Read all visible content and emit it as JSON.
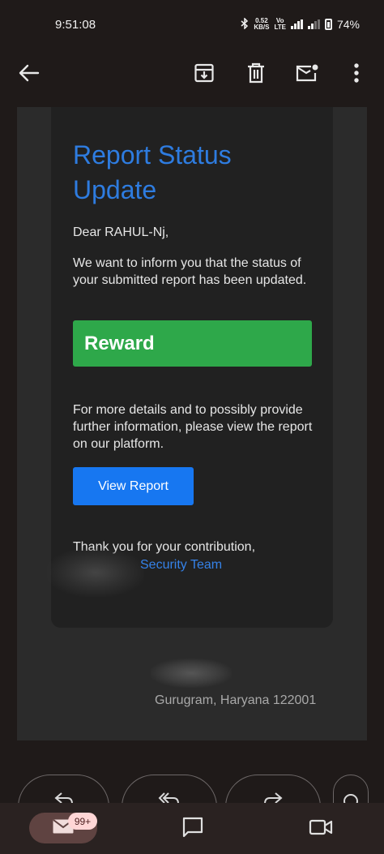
{
  "status_bar": {
    "time": "9:51:08",
    "net_speed_value": "0.52",
    "net_speed_unit": "KB/S",
    "volte_top": "Vo",
    "volte_bottom": "LTE",
    "battery": "74%"
  },
  "toolbar": {
    "icons": [
      "back-arrow-icon",
      "archive-icon",
      "delete-icon",
      "mark-unread-icon",
      "more-vert-icon"
    ]
  },
  "email": {
    "title": "Report Status Update",
    "greeting": "Dear RAHUL-Nj,",
    "intro": "We want to inform you that the status of your submitted report has been updated.",
    "status_label": "Reward",
    "details": "For more details and to possibly provide further information, please view the report on our platform.",
    "view_button": "View Report",
    "thanks": "Thank you for your contribution,",
    "team": "Security Team",
    "address": "Gurugram, Haryana 122001"
  },
  "actions": {
    "icons": [
      "reply-icon",
      "reply-all-icon",
      "forward-icon",
      "emoji-icon"
    ]
  },
  "bottom_nav": {
    "mail_badge": "99+",
    "icons": [
      "mail-icon",
      "chat-icon",
      "video-icon"
    ]
  },
  "colors": {
    "title_blue": "#2e7ce0",
    "reward_green": "#2ea84a",
    "button_blue": "#1777f1",
    "background": "#1f1a19"
  }
}
